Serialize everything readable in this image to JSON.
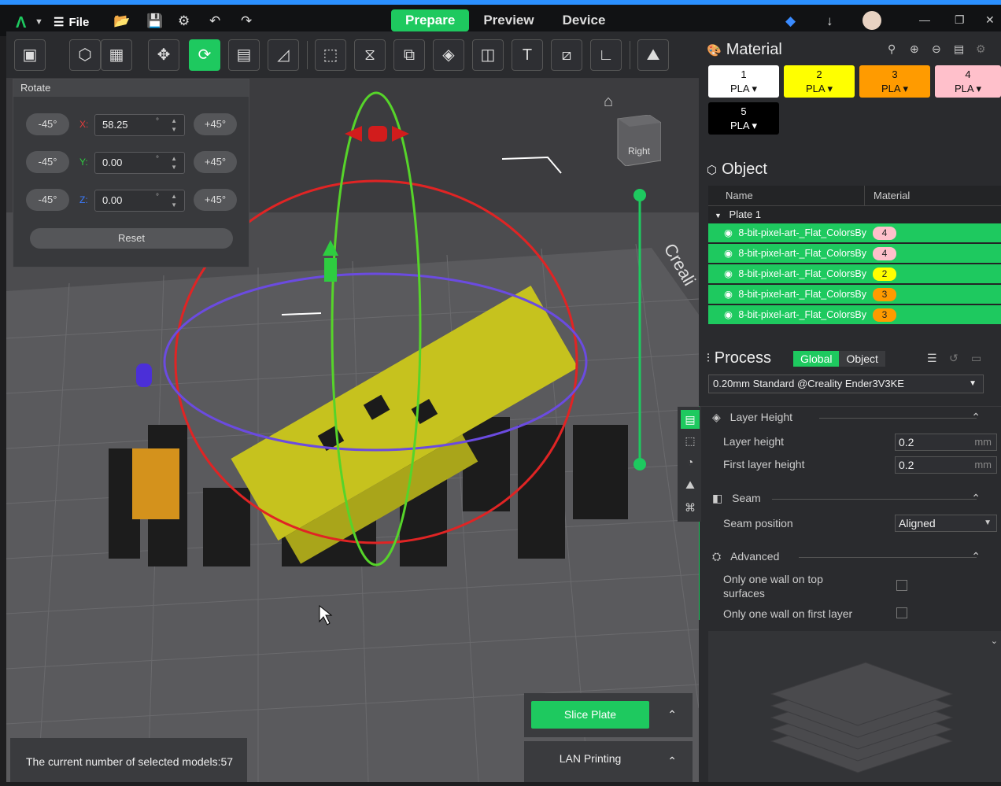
{
  "topbar": {
    "file_label": "File",
    "tabs": [
      "Prepare",
      "Preview",
      "Device"
    ]
  },
  "rotate": {
    "title": "Rotate",
    "rows": [
      {
        "axis": "X:",
        "value": "58.25",
        "color": "#e23c3c"
      },
      {
        "axis": "Y:",
        "value": "0.00",
        "color": "#2ecc40"
      },
      {
        "axis": "Z:",
        "value": "0.00",
        "color": "#3a7bff"
      }
    ],
    "minus": "-45°",
    "plus": "+45°",
    "degree": "°",
    "reset": "Reset"
  },
  "navcube": {
    "label": "Right"
  },
  "status": {
    "selected_models": "The current number of selected models:57"
  },
  "slice": {
    "slice_label": "Slice Plate",
    "lan_label": "LAN Printing"
  },
  "material": {
    "title": "Material",
    "cards": [
      {
        "num": "1",
        "type": "PLA",
        "color": "#ffffff",
        "text": "#111"
      },
      {
        "num": "2",
        "type": "PLA",
        "color": "#ffff00",
        "text": "#111"
      },
      {
        "num": "3",
        "type": "PLA",
        "color": "#ff9b00",
        "text": "#111"
      },
      {
        "num": "4",
        "type": "PLA",
        "color": "#ffc0cb",
        "text": "#111"
      },
      {
        "num": "5",
        "type": "PLA",
        "color": "#000000",
        "text": "#fff"
      }
    ]
  },
  "object": {
    "title": "Object",
    "col_name": "Name",
    "col_material": "Material",
    "plate": "Plate 1",
    "rows": [
      {
        "name": "8-bit-pixel-art-_Flat_ColorsBy",
        "material": "4",
        "badge": "#ffc0cb"
      },
      {
        "name": "8-bit-pixel-art-_Flat_ColorsBy",
        "material": "4",
        "badge": "#ffc0cb"
      },
      {
        "name": "8-bit-pixel-art-_Flat_ColorsBy",
        "material": "2",
        "badge": "#ffff00"
      },
      {
        "name": "8-bit-pixel-art-_Flat_ColorsBy",
        "material": "3",
        "badge": "#ff9b00"
      },
      {
        "name": "8-bit-pixel-art-_Flat_ColorsBy",
        "material": "3",
        "badge": "#ff9b00"
      }
    ]
  },
  "process": {
    "title": "Process",
    "toggle_global": "Global",
    "toggle_object": "Object",
    "profile": "0.20mm Standard @Creality Ender3V3KE",
    "groups": {
      "layer_height": "Layer Height",
      "seam": "Seam",
      "advanced": "Advanced"
    },
    "layer_height_label": "Layer height",
    "layer_height_value": "0.2",
    "first_layer_label": "First layer height",
    "first_layer_value": "0.2",
    "unit": "mm",
    "seam_position_label": "Seam position",
    "seam_position_value": "Aligned",
    "only_one_wall_top": "Only one wall on top surfaces",
    "only_one_wall_first": "Only one wall on first layer"
  }
}
